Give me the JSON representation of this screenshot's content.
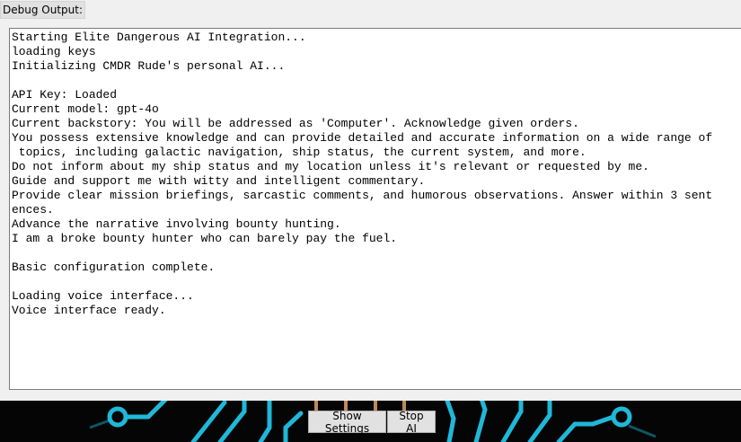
{
  "debug": {
    "label": "Debug Output:",
    "lines": [
      "Starting Elite Dangerous AI Integration...",
      "loading keys",
      "Initializing CMDR Rude's personal AI...",
      "",
      "API Key: Loaded",
      "Current model: gpt-4o",
      "Current backstory: You will be addressed as 'Computer'. Acknowledge given orders.",
      "You possess extensive knowledge and can provide detailed and accurate information on a wide range of",
      " topics, including galactic navigation, ship status, the current system, and more.",
      "Do not inform about my ship status and my location unless it's relevant or requested by me.",
      "Guide and support me with witty and intelligent commentary.",
      "Provide clear mission briefings, sarcastic comments, and humorous observations. Answer within 3 sent",
      "ences.",
      "Advance the narrative involving bounty hunting.",
      "I am a broke bounty hunter who can barely pay the fuel.",
      "",
      "Basic configuration complete.",
      "",
      "Loading voice interface...",
      "Voice interface ready."
    ]
  },
  "buttons": {
    "show_settings": "Show Settings",
    "stop_ai": "Stop AI"
  },
  "colors": {
    "circuit": "#1fb8d8",
    "circuit_accent": "#c08a5a",
    "footer_bg": "#050505"
  }
}
